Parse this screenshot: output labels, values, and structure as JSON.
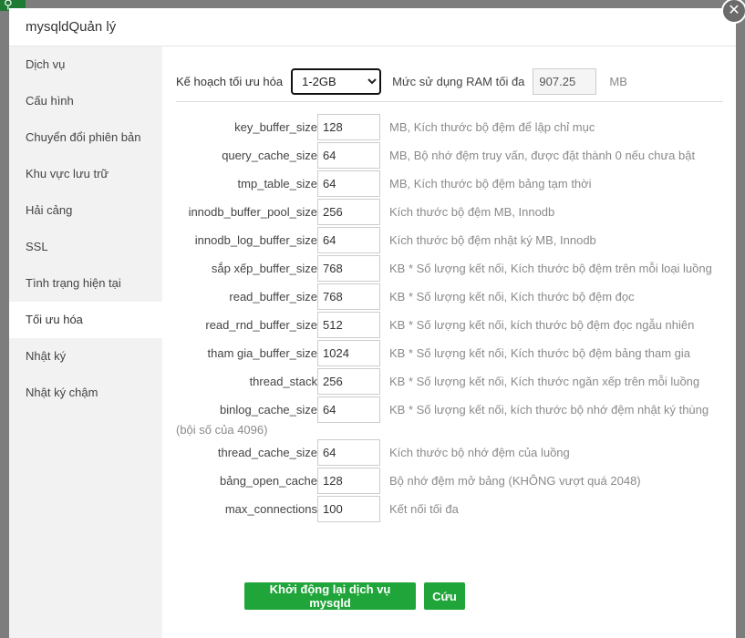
{
  "modal": {
    "title": "mysqldQuản lý",
    "close_glyph": "✕"
  },
  "sidebar": {
    "items": [
      {
        "label": "Dịch vụ"
      },
      {
        "label": "Cấu hình"
      },
      {
        "label": "Chuyển đổi phiên bản"
      },
      {
        "label": "Khu vực lưu trữ"
      },
      {
        "label": "Hải cảng"
      },
      {
        "label": "SSL"
      },
      {
        "label": "Tình trạng hiện tại"
      },
      {
        "label": "Tối ưu hóa"
      },
      {
        "label": "Nhật ký"
      },
      {
        "label": "Nhật ký chậm"
      }
    ],
    "active_index": 7
  },
  "optimization": {
    "plan_label": "Kế hoạch tối ưu hóa",
    "plan_value": "1-2GB",
    "ram_label": "Mức sử dụng RAM tối đa",
    "ram_value": "907.25",
    "ram_unit": "MB",
    "params": [
      {
        "name": "key_buffer_size",
        "value": "128",
        "desc": "MB, Kích thước bộ đệm để lập chỉ mục"
      },
      {
        "name": "query_cache_size",
        "value": "64",
        "desc": "MB, Bộ nhớ đệm truy vấn, được đặt thành 0 nếu chưa bật"
      },
      {
        "name": "tmp_table_size",
        "value": "64",
        "desc": "MB, Kích thước bộ đệm bảng tạm thời"
      },
      {
        "name": "innodb_buffer_pool_size",
        "value": "256",
        "desc": "Kích thước bộ đệm MB, Innodb"
      },
      {
        "name": "innodb_log_buffer_size",
        "value": "64",
        "desc": "Kích thước bộ đệm nhật ký MB, Innodb"
      },
      {
        "name": "sắp xếp_buffer_size",
        "value": "768",
        "desc": "KB * Số lượng kết nối, Kích thước bộ đệm trên mỗi loại luồng"
      },
      {
        "name": "read_buffer_size",
        "value": "768",
        "desc": "KB * Số lượng kết nối, Kích thước bộ đệm đọc"
      },
      {
        "name": "read_rnd_buffer_size",
        "value": "512",
        "desc": "KB * Số lượng kết nối, kích thước bộ đệm đọc ngẫu nhiên"
      },
      {
        "name": "tham gia_buffer_size",
        "value": "1024",
        "desc": "KB * Số lượng kết nối, Kích thước bộ đệm bảng tham gia"
      },
      {
        "name": "thread_stack",
        "value": "256",
        "desc": "KB * Số lượng kết nối, Kích thước ngăn xếp trên mỗi luồng"
      },
      {
        "name": "binlog_cache_size",
        "value": "64",
        "desc": "KB * Số lượng kết nối, kích thước bộ nhớ đệm nhật ký thùng",
        "desc_wrap": "(bội số của 4096)"
      },
      {
        "name": "thread_cache_size",
        "value": "64",
        "desc": "Kích thước bộ nhớ đệm của luồng"
      },
      {
        "name": "bảng_open_cache",
        "value": "128",
        "desc": "Bộ nhớ đệm mở bảng (KHÔNG vượt quá 2048)"
      },
      {
        "name": "max_connections",
        "value": "100",
        "desc": "Kết nối tối đa"
      }
    ],
    "restart_button": "Khởi động lại dịch vụ mysqld",
    "save_button": "Cứu"
  },
  "colors": {
    "accent": "#20a53a",
    "sidebar_bg": "#f2f2f2",
    "overlay": "#7d7d7d"
  }
}
